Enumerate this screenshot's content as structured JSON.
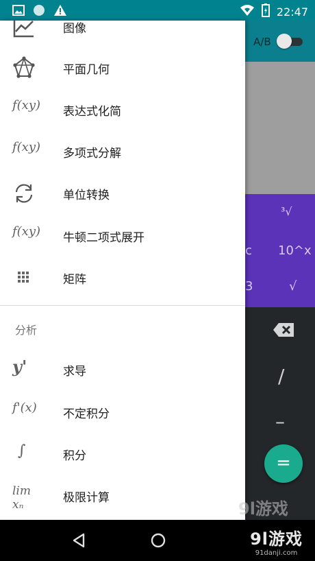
{
  "status_bar": {
    "time": "22:47"
  },
  "calculator": {
    "toggle_label": "A/B",
    "sci_keys": [
      "³√",
      "c",
      "10^x",
      "3",
      "√"
    ],
    "keys": [
      "/",
      "–"
    ],
    "fab_label": "="
  },
  "drawer": {
    "items_top": [
      {
        "label": "图像",
        "icon": "chart-line-icon"
      },
      {
        "label": "平面几何",
        "icon": "geometry-icon"
      },
      {
        "label": "表达式化简",
        "icon": "function-icon"
      },
      {
        "label": "多项式分解",
        "icon": "function-icon"
      },
      {
        "label": "单位转换",
        "icon": "sync-icon"
      },
      {
        "label": "牛顿二项式展开",
        "icon": "function-icon"
      },
      {
        "label": "矩阵",
        "icon": "grid-icon"
      }
    ],
    "section_title": "分析",
    "items_analysis": [
      {
        "label": "求导",
        "icon": "derivative-icon"
      },
      {
        "label": "不定积分",
        "icon": "antiderivative-icon"
      },
      {
        "label": "积分",
        "icon": "integral-icon"
      },
      {
        "label": "极限计算",
        "icon": "limit-icon"
      }
    ],
    "icon_text": {
      "fxy": "f(xy)",
      "y_prime": "y'",
      "f_prime": "f'(x)",
      "integral": "∫",
      "lim": "lim xₙ"
    }
  },
  "watermark": {
    "brand": "9l游戏",
    "url": "91danji.com",
    "brand2": "9l游戏"
  }
}
